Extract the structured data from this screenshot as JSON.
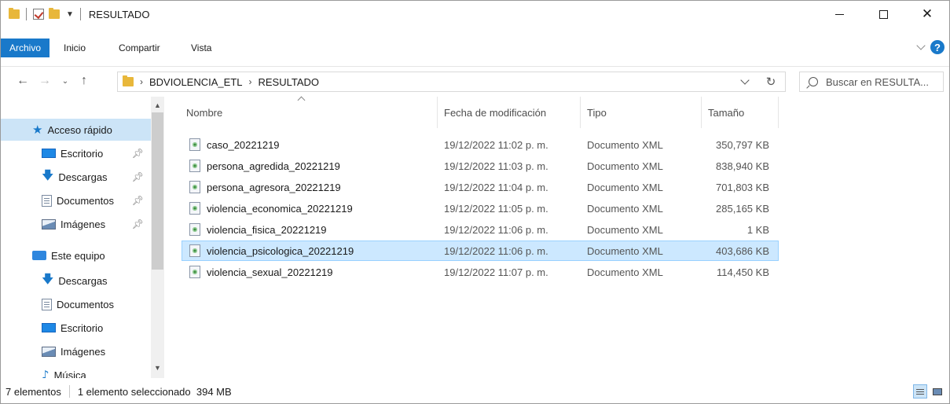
{
  "window": {
    "title": "RESULTADO"
  },
  "ribbon": {
    "tabs": [
      "Archivo",
      "Inicio",
      "Compartir",
      "Vista"
    ]
  },
  "address": {
    "crumbs": [
      "BDVIOLENCIA_ETL",
      "RESULTADO"
    ]
  },
  "search": {
    "placeholder": "Buscar en RESULTA..."
  },
  "nav": {
    "quick_access": "Acceso rápido",
    "quick_items": [
      "Escritorio",
      "Descargas",
      "Documentos",
      "Imágenes"
    ],
    "this_pc": "Este equipo",
    "pc_items": [
      "Descargas",
      "Documentos",
      "Escritorio",
      "Imágenes",
      "Música"
    ]
  },
  "columns": {
    "name": "Nombre",
    "date": "Fecha de modificación",
    "type": "Tipo",
    "size": "Tamaño"
  },
  "files": [
    {
      "name": "caso_20221219",
      "date": "19/12/2022 11:02 p. m.",
      "type": "Documento XML",
      "size": "350,797 KB"
    },
    {
      "name": "persona_agredida_20221219",
      "date": "19/12/2022 11:03 p. m.",
      "type": "Documento XML",
      "size": "838,940 KB"
    },
    {
      "name": "persona_agresora_20221219",
      "date": "19/12/2022 11:04 p. m.",
      "type": "Documento XML",
      "size": "701,803 KB"
    },
    {
      "name": "violencia_economica_20221219",
      "date": "19/12/2022 11:05 p. m.",
      "type": "Documento XML",
      "size": "285,165 KB"
    },
    {
      "name": "violencia_fisica_20221219",
      "date": "19/12/2022 11:06 p. m.",
      "type": "Documento XML",
      "size": "1 KB"
    },
    {
      "name": "violencia_psicologica_20221219",
      "date": "19/12/2022 11:06 p. m.",
      "type": "Documento XML",
      "size": "403,686 KB"
    },
    {
      "name": "violencia_sexual_20221219",
      "date": "19/12/2022 11:07 p. m.",
      "type": "Documento XML",
      "size": "114,450 KB"
    }
  ],
  "status": {
    "count": "7 elementos",
    "selection": "1 elemento seleccionado  394 MB"
  },
  "colors": {
    "accent": "#1979ca",
    "selection": "#cce8ff"
  }
}
